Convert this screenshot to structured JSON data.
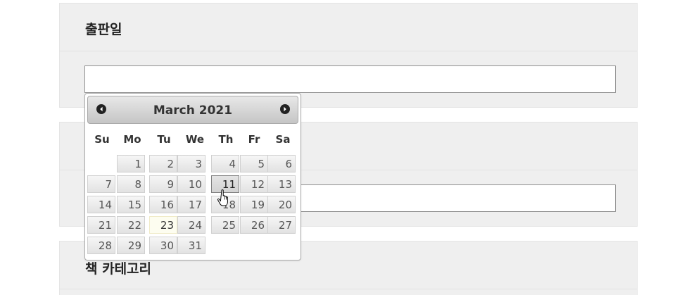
{
  "sections": [
    {
      "title": "출판일"
    },
    {
      "title": ""
    },
    {
      "title": "책 카테고리"
    }
  ],
  "datepicker": {
    "month": "March",
    "year": "2021",
    "weekdays": [
      "Su",
      "Mo",
      "Tu",
      "We",
      "Th",
      "Fr",
      "Sa"
    ],
    "first_weekday": 1,
    "days": [
      "1",
      "2",
      "3",
      "4",
      "5",
      "6",
      "7",
      "8",
      "9",
      "10",
      "11",
      "12",
      "13",
      "14",
      "15",
      "16",
      "17",
      "18",
      "19",
      "20",
      "21",
      "22",
      "23",
      "24",
      "25",
      "26",
      "27",
      "28",
      "29",
      "30",
      "31"
    ],
    "today": 23,
    "hovered": 11,
    "prev_icon": "chevron-left-icon",
    "next_icon": "chevron-right-icon"
  },
  "cursor": "hand-pointer-icon"
}
